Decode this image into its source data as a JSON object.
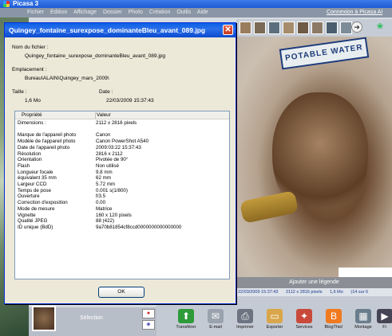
{
  "picasa": {
    "title": "Picasa 3",
    "menu": [
      "Fichier",
      "Edition",
      "Affichage",
      "Dossier",
      "Photo",
      "Création",
      "Outils",
      "Aide"
    ],
    "connect_link": "Connexion à Picasa Al",
    "caption_placeholder": "Ajouter une légende",
    "info": [
      "22/03/2009 15:37:43",
      "2112 x 2816 pixels",
      "1,6 Mo",
      "(14 sur 6"
    ],
    "photo_sign": "POTABLE WATER",
    "selection_label": "Sélection",
    "zoom_buttons": [
      "◆",
      "◎",
      "▭"
    ],
    "actions": [
      {
        "label": "Transférer",
        "icon": "upload-icon",
        "color": "#2e9a3a",
        "glyph": "⬆"
      },
      {
        "label": "E-mail",
        "icon": "email-icon",
        "color": "#9aa3ad",
        "glyph": "✉"
      },
      {
        "label": "Imprimer",
        "icon": "print-icon",
        "color": "#6b7480",
        "glyph": "⎙"
      },
      {
        "label": "Exporter",
        "icon": "folder-icon",
        "color": "#d9a64a",
        "glyph": "▭"
      },
      {
        "label": "Services",
        "icon": "services-icon",
        "color": "#c94a3a",
        "glyph": "✦"
      },
      {
        "label": "BlogThis!",
        "icon": "blogger-icon",
        "color": "#f07a20",
        "glyph": "B"
      },
      {
        "label": "Montage",
        "icon": "collage-icon",
        "color": "#6a7d8c",
        "glyph": "▦"
      },
      {
        "label": "Fi",
        "icon": "movie-icon",
        "color": "#445",
        "glyph": "▶"
      }
    ]
  },
  "dialog": {
    "title": "Quingey_fontaine_surexpose_dominanteBleu_avant_089.jpg",
    "close_glyph": "✕",
    "filename_label": "Nom du fichier :",
    "filename_value": "Quingey_fontaine_surexpose_dominanteBleu_avant_089.jpg",
    "location_label": "Emplacement :",
    "location_value": "Bureau\\ALAIN\\Quingey_mars_2009\\",
    "size_label": "Taille :",
    "size_value": "1,6 Mo",
    "date_label": "Date :",
    "date_value": "22/03/2009 15:37:43",
    "columns": [
      "Propriété",
      "Valeur"
    ],
    "rows": [
      [
        "Dimensions :",
        "2112 x 2816 pixels"
      ],
      [
        "",
        ""
      ],
      [
        "Marque de l'appareil photo",
        "Canon"
      ],
      [
        "Modèle de l'appareil photo",
        "Canon PowerShot A540"
      ],
      [
        "Date de l'appareil photo",
        "2009:03:22 15:37:43"
      ],
      [
        "Résolution",
        "2816 x 2112"
      ],
      [
        "Orientation",
        "Pivotée de 90°"
      ],
      [
        "Flash",
        "Non utilisé"
      ],
      [
        "Longueur focale",
        "9.8 mm"
      ],
      [
        "équivalent 35 mm",
        "62 mm"
      ],
      [
        "Largeur CCD",
        "5.72 mm"
      ],
      [
        "Temps de pose",
        "0.001 s(1/800)"
      ],
      [
        "Ouverture",
        "f/3.5"
      ],
      [
        "Correction d'exposition",
        "0.00"
      ],
      [
        "Mode de mesure",
        "Matrice"
      ],
      [
        "Vignette",
        "160 x 120 pixels"
      ],
      [
        "Qualité JPEG",
        "88 (422)"
      ],
      [
        "ID unique (BdD)",
        "9a70b81854cf8ccd0000000000000000"
      ]
    ],
    "ok_label": "OK"
  }
}
